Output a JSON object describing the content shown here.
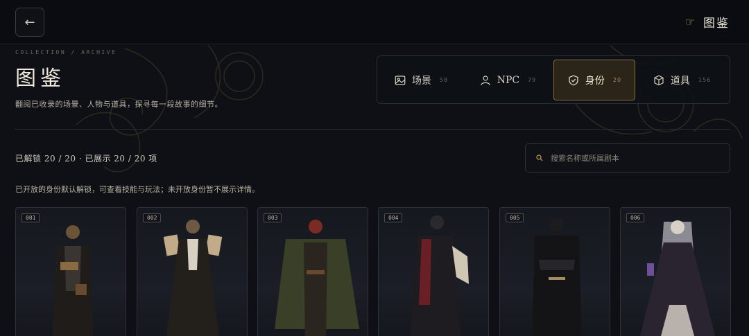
{
  "header": {
    "back_icon": "←",
    "title": "图鉴",
    "title_icon": "☞"
  },
  "hero": {
    "eyebrow": "COLLECTION / ARCHIVE",
    "title": "图鉴",
    "subtitle": "翻阅已收录的场景、人物与道具，探寻每一段故事的细节。"
  },
  "tabs": [
    {
      "label": "场景",
      "count": "58",
      "icon": "image-icon"
    },
    {
      "label": "NPC",
      "count": "79",
      "icon": "user-icon"
    },
    {
      "label": "身份",
      "count": "20",
      "icon": "shield-check-icon",
      "active": true
    },
    {
      "label": "道具",
      "count": "156",
      "icon": "box-icon"
    }
  ],
  "stats": "已解锁 20 / 20 · 已展示 20 / 20 项",
  "search": {
    "placeholder": "搜索名称或所属剧本"
  },
  "note": "已开放的身份默认解锁，可查看技能与玩法；未开放身份暂不展示详情。",
  "cards": [
    {
      "num": "001"
    },
    {
      "num": "002"
    },
    {
      "num": "003"
    },
    {
      "num": "004"
    },
    {
      "num": "005"
    },
    {
      "num": "006"
    }
  ],
  "colors": {
    "accent": "#c9a45d",
    "background": "#0e1016",
    "active_tab_bg": "#2b2418",
    "active_tab_border": "#8a6d3d"
  }
}
